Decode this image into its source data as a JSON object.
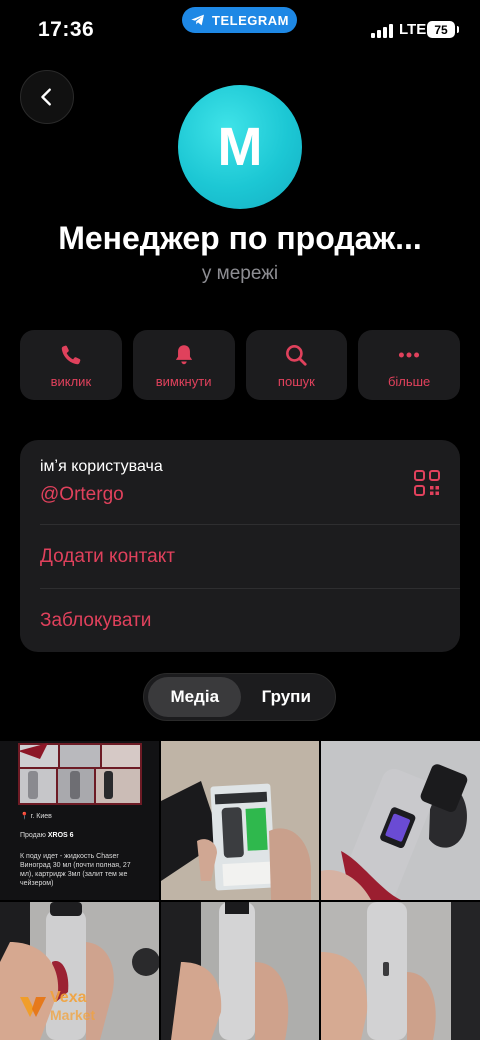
{
  "status_bar": {
    "time": "17:36",
    "app_pill": "TELEGRAM",
    "network": "LTE",
    "battery": "75"
  },
  "profile": {
    "avatar_letter": "M",
    "name": "Менеджер по продаж...",
    "presence": "у мережі"
  },
  "actions": [
    {
      "label": "виклик",
      "icon": "phone-icon"
    },
    {
      "label": "вимкнути",
      "icon": "bell-icon"
    },
    {
      "label": "пошук",
      "icon": "search-icon"
    },
    {
      "label": "більше",
      "icon": "more-dots-icon"
    }
  ],
  "info": {
    "username_caption": "імʼя користувача",
    "username": "@Ortergo",
    "add_contact": "Додати контакт",
    "block": "Заблокувати"
  },
  "tabs": [
    {
      "label": "Медіа",
      "selected": true
    },
    {
      "label": "Групи",
      "selected": false
    }
  ],
  "media_post": {
    "location": "г. Киев",
    "line1_prefix": "Продаю ",
    "line1_bold": "XROS 6",
    "body": "К поду идет - жидкость Chaser Виноград 30 мл (почти полная, 27 мл), картридж 3мл (залит тем же чейзером)"
  },
  "watermark": {
    "line1": "Vexa",
    "line2": "Market"
  },
  "colors": {
    "accent": "#e0415c",
    "card": "#1c1c1e",
    "avatar": "#1cc7d4",
    "telegram_pill": "#1e88e5"
  }
}
